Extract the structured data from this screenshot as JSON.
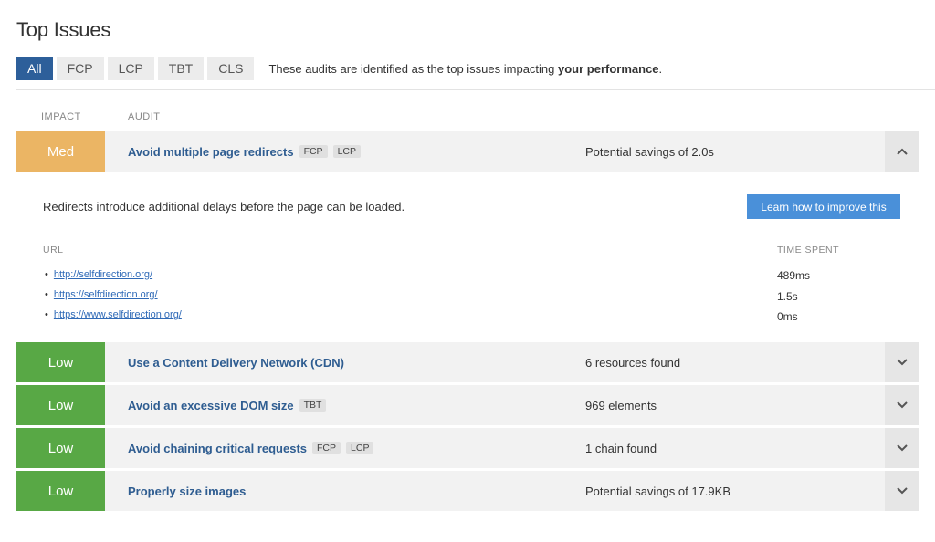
{
  "title": "Top Issues",
  "tabs": [
    {
      "label": "All",
      "active": true
    },
    {
      "label": "FCP",
      "active": false
    },
    {
      "label": "LCP",
      "active": false
    },
    {
      "label": "TBT",
      "active": false
    },
    {
      "label": "CLS",
      "active": false
    }
  ],
  "tabs_description": {
    "prefix": "These audits are identified as the top issues impacting ",
    "bold": "your performance",
    "suffix": "."
  },
  "columns": {
    "impact": "IMPACT",
    "audit": "AUDIT"
  },
  "issues": [
    {
      "impact": "Med",
      "impact_color": "#ebb564",
      "name": "Avoid multiple page redirects",
      "tags": [
        "FCP",
        "LCP"
      ],
      "result": "Potential savings of 2.0s",
      "toggle_icon": "chevron-up-icon",
      "expanded": true
    },
    {
      "impact": "Low",
      "impact_color": "#58a845",
      "name": "Use a Content Delivery Network (CDN)",
      "tags": [],
      "result": "6 resources found",
      "toggle_icon": "chevron-down-icon",
      "expanded": false
    },
    {
      "impact": "Low",
      "impact_color": "#58a845",
      "name": "Avoid an excessive DOM size",
      "tags": [
        "TBT"
      ],
      "result": "969 elements",
      "toggle_icon": "chevron-down-icon",
      "expanded": false
    },
    {
      "impact": "Low",
      "impact_color": "#58a845",
      "name": "Avoid chaining critical requests",
      "tags": [
        "FCP",
        "LCP"
      ],
      "result": "1 chain found",
      "toggle_icon": "chevron-down-icon",
      "expanded": false
    },
    {
      "impact": "Low",
      "impact_color": "#58a845",
      "name": "Properly size images",
      "tags": [],
      "result": "Potential savings of 17.9KB",
      "toggle_icon": "chevron-down-icon",
      "expanded": false
    }
  ],
  "detail": {
    "description": "Redirects introduce additional delays before the page can be loaded.",
    "learn_button": "Learn how to improve this",
    "url_header": "URL",
    "time_header": "TIME SPENT",
    "rows": [
      {
        "url": "http://selfdirection.org/",
        "time": "489ms"
      },
      {
        "url": "https://selfdirection.org/",
        "time": "1.5s"
      },
      {
        "url": "https://www.selfdirection.org/",
        "time": "0ms"
      }
    ]
  },
  "colors": {
    "accent": "#2d5f9a",
    "link": "#2f5d91",
    "button": "#4a90d9",
    "med": "#ebb564",
    "low": "#58a845"
  }
}
